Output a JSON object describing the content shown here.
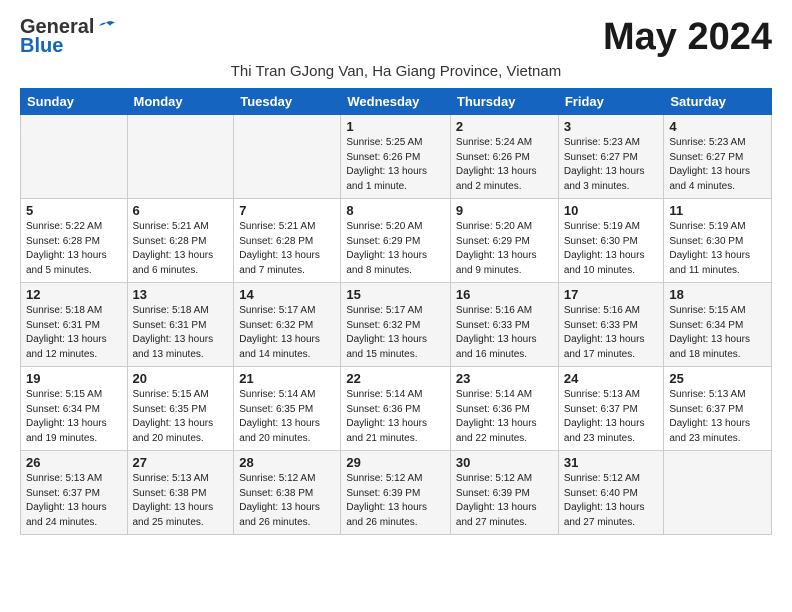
{
  "header": {
    "logo_general": "General",
    "logo_blue": "Blue",
    "month_title": "May 2024",
    "subtitle": "Thi Tran GJong Van, Ha Giang Province, Vietnam"
  },
  "weekdays": [
    "Sunday",
    "Monday",
    "Tuesday",
    "Wednesday",
    "Thursday",
    "Friday",
    "Saturday"
  ],
  "weeks": [
    [
      {
        "day": "",
        "info": ""
      },
      {
        "day": "",
        "info": ""
      },
      {
        "day": "",
        "info": ""
      },
      {
        "day": "1",
        "info": "Sunrise: 5:25 AM\nSunset: 6:26 PM\nDaylight: 13 hours\nand 1 minute."
      },
      {
        "day": "2",
        "info": "Sunrise: 5:24 AM\nSunset: 6:26 PM\nDaylight: 13 hours\nand 2 minutes."
      },
      {
        "day": "3",
        "info": "Sunrise: 5:23 AM\nSunset: 6:27 PM\nDaylight: 13 hours\nand 3 minutes."
      },
      {
        "day": "4",
        "info": "Sunrise: 5:23 AM\nSunset: 6:27 PM\nDaylight: 13 hours\nand 4 minutes."
      }
    ],
    [
      {
        "day": "5",
        "info": "Sunrise: 5:22 AM\nSunset: 6:28 PM\nDaylight: 13 hours\nand 5 minutes."
      },
      {
        "day": "6",
        "info": "Sunrise: 5:21 AM\nSunset: 6:28 PM\nDaylight: 13 hours\nand 6 minutes."
      },
      {
        "day": "7",
        "info": "Sunrise: 5:21 AM\nSunset: 6:28 PM\nDaylight: 13 hours\nand 7 minutes."
      },
      {
        "day": "8",
        "info": "Sunrise: 5:20 AM\nSunset: 6:29 PM\nDaylight: 13 hours\nand 8 minutes."
      },
      {
        "day": "9",
        "info": "Sunrise: 5:20 AM\nSunset: 6:29 PM\nDaylight: 13 hours\nand 9 minutes."
      },
      {
        "day": "10",
        "info": "Sunrise: 5:19 AM\nSunset: 6:30 PM\nDaylight: 13 hours\nand 10 minutes."
      },
      {
        "day": "11",
        "info": "Sunrise: 5:19 AM\nSunset: 6:30 PM\nDaylight: 13 hours\nand 11 minutes."
      }
    ],
    [
      {
        "day": "12",
        "info": "Sunrise: 5:18 AM\nSunset: 6:31 PM\nDaylight: 13 hours\nand 12 minutes."
      },
      {
        "day": "13",
        "info": "Sunrise: 5:18 AM\nSunset: 6:31 PM\nDaylight: 13 hours\nand 13 minutes."
      },
      {
        "day": "14",
        "info": "Sunrise: 5:17 AM\nSunset: 6:32 PM\nDaylight: 13 hours\nand 14 minutes."
      },
      {
        "day": "15",
        "info": "Sunrise: 5:17 AM\nSunset: 6:32 PM\nDaylight: 13 hours\nand 15 minutes."
      },
      {
        "day": "16",
        "info": "Sunrise: 5:16 AM\nSunset: 6:33 PM\nDaylight: 13 hours\nand 16 minutes."
      },
      {
        "day": "17",
        "info": "Sunrise: 5:16 AM\nSunset: 6:33 PM\nDaylight: 13 hours\nand 17 minutes."
      },
      {
        "day": "18",
        "info": "Sunrise: 5:15 AM\nSunset: 6:34 PM\nDaylight: 13 hours\nand 18 minutes."
      }
    ],
    [
      {
        "day": "19",
        "info": "Sunrise: 5:15 AM\nSunset: 6:34 PM\nDaylight: 13 hours\nand 19 minutes."
      },
      {
        "day": "20",
        "info": "Sunrise: 5:15 AM\nSunset: 6:35 PM\nDaylight: 13 hours\nand 20 minutes."
      },
      {
        "day": "21",
        "info": "Sunrise: 5:14 AM\nSunset: 6:35 PM\nDaylight: 13 hours\nand 20 minutes."
      },
      {
        "day": "22",
        "info": "Sunrise: 5:14 AM\nSunset: 6:36 PM\nDaylight: 13 hours\nand 21 minutes."
      },
      {
        "day": "23",
        "info": "Sunrise: 5:14 AM\nSunset: 6:36 PM\nDaylight: 13 hours\nand 22 minutes."
      },
      {
        "day": "24",
        "info": "Sunrise: 5:13 AM\nSunset: 6:37 PM\nDaylight: 13 hours\nand 23 minutes."
      },
      {
        "day": "25",
        "info": "Sunrise: 5:13 AM\nSunset: 6:37 PM\nDaylight: 13 hours\nand 23 minutes."
      }
    ],
    [
      {
        "day": "26",
        "info": "Sunrise: 5:13 AM\nSunset: 6:37 PM\nDaylight: 13 hours\nand 24 minutes."
      },
      {
        "day": "27",
        "info": "Sunrise: 5:13 AM\nSunset: 6:38 PM\nDaylight: 13 hours\nand 25 minutes."
      },
      {
        "day": "28",
        "info": "Sunrise: 5:12 AM\nSunset: 6:38 PM\nDaylight: 13 hours\nand 26 minutes."
      },
      {
        "day": "29",
        "info": "Sunrise: 5:12 AM\nSunset: 6:39 PM\nDaylight: 13 hours\nand 26 minutes."
      },
      {
        "day": "30",
        "info": "Sunrise: 5:12 AM\nSunset: 6:39 PM\nDaylight: 13 hours\nand 27 minutes."
      },
      {
        "day": "31",
        "info": "Sunrise: 5:12 AM\nSunset: 6:40 PM\nDaylight: 13 hours\nand 27 minutes."
      },
      {
        "day": "",
        "info": ""
      }
    ]
  ]
}
